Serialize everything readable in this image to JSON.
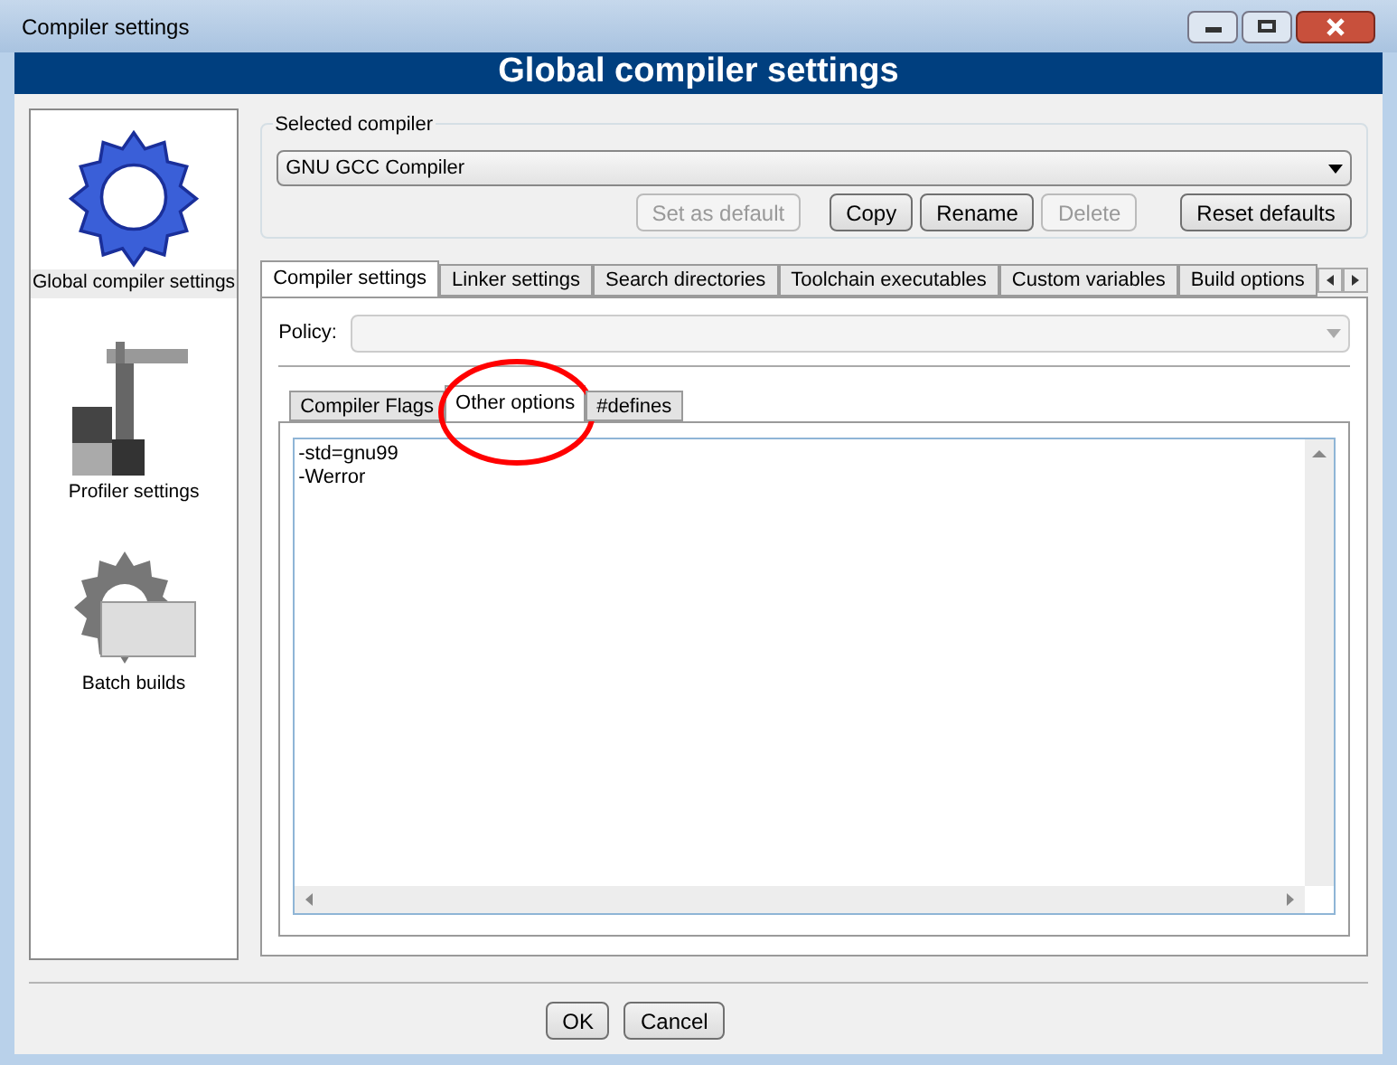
{
  "window": {
    "title": "Compiler settings"
  },
  "header": "Global compiler settings",
  "sidebar": {
    "items": [
      {
        "label": "Global compiler settings",
        "kind": "gear",
        "selected": true
      },
      {
        "label": "Profiler settings",
        "kind": "profiler",
        "selected": false
      },
      {
        "label": "Batch builds",
        "kind": "batch",
        "selected": false
      }
    ]
  },
  "compiler_group": {
    "title": "Selected compiler",
    "value": "GNU GCC Compiler",
    "buttons": [
      {
        "label": "Set as default",
        "disabled": true
      },
      {
        "label": "Copy",
        "disabled": false
      },
      {
        "label": "Rename",
        "disabled": false
      },
      {
        "label": "Delete",
        "disabled": true
      },
      {
        "label": "Reset defaults",
        "disabled": false
      }
    ]
  },
  "tabs": [
    {
      "label": "Compiler settings",
      "selected": true
    },
    {
      "label": "Linker settings",
      "selected": false
    },
    {
      "label": "Search directories",
      "selected": false
    },
    {
      "label": "Toolchain executables",
      "selected": false
    },
    {
      "label": "Custom variables",
      "selected": false
    },
    {
      "label": "Build options",
      "selected": false
    }
  ],
  "policy": {
    "label": "Policy:",
    "disabled": true
  },
  "subtabs": [
    {
      "label": "Compiler Flags",
      "selected": false,
      "circled": false
    },
    {
      "label": "Other options",
      "selected": true,
      "circled": true
    },
    {
      "label": "#defines",
      "selected": false,
      "circled": false
    }
  ],
  "options_text": [
    "-std=gnu99",
    "-Werror"
  ],
  "buttons": [
    "OK",
    "Cancel"
  ]
}
